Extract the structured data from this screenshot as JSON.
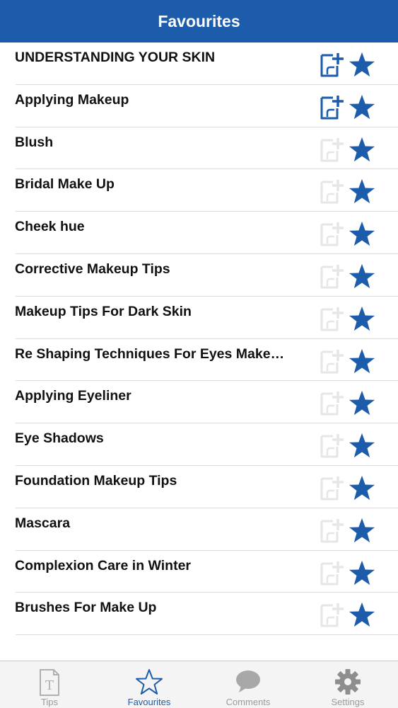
{
  "header": {
    "title": "Favourites"
  },
  "colors": {
    "accent": "#1d5bab",
    "note_active": "#1d5bab",
    "note_inactive": "#e6e6e6",
    "tab_inactive": "#9a9a9a"
  },
  "favourites": [
    {
      "label": "UNDERSTANDING YOUR SKIN",
      "note_icon": "add-note-icon",
      "note_active": true
    },
    {
      "label": "Applying Makeup",
      "note_icon": "add-note-icon",
      "note_active": true
    },
    {
      "label": "Blush",
      "note_icon": "add-note-icon",
      "note_active": false
    },
    {
      "label": "Bridal Make Up",
      "note_icon": "add-note-icon",
      "note_active": false
    },
    {
      "label": "Cheek hue",
      "note_icon": "add-note-icon",
      "note_active": false
    },
    {
      "label": "Corrective Makeup Tips",
      "note_icon": "add-note-icon",
      "note_active": false
    },
    {
      "label": "Makeup Tips For Dark Skin",
      "note_icon": "add-note-icon",
      "note_active": false
    },
    {
      "label": "Re Shaping Techniques For Eyes Make…",
      "note_icon": "add-note-icon",
      "note_active": false
    },
    {
      "label": "Applying Eyeliner",
      "note_icon": "add-note-icon",
      "note_active": false
    },
    {
      "label": "Eye Shadows",
      "note_icon": "add-note-icon",
      "note_active": false
    },
    {
      "label": "Foundation Makeup Tips",
      "note_icon": "add-note-icon",
      "note_active": false
    },
    {
      "label": "Mascara",
      "note_icon": "add-note-icon",
      "note_active": false
    },
    {
      "label": "Complexion Care in Winter",
      "note_icon": "add-note-icon",
      "note_active": false
    },
    {
      "label": "Brushes For Make Up",
      "note_icon": "add-note-icon",
      "note_active": false
    }
  ],
  "tabbar": {
    "tabs": [
      {
        "label": "Tips",
        "icon": "tips-icon",
        "active": false
      },
      {
        "label": "Favourites",
        "icon": "star-icon",
        "active": true
      },
      {
        "label": "Comments",
        "icon": "comments-icon",
        "active": false
      },
      {
        "label": "Settings",
        "icon": "gear-icon",
        "active": false
      }
    ]
  }
}
